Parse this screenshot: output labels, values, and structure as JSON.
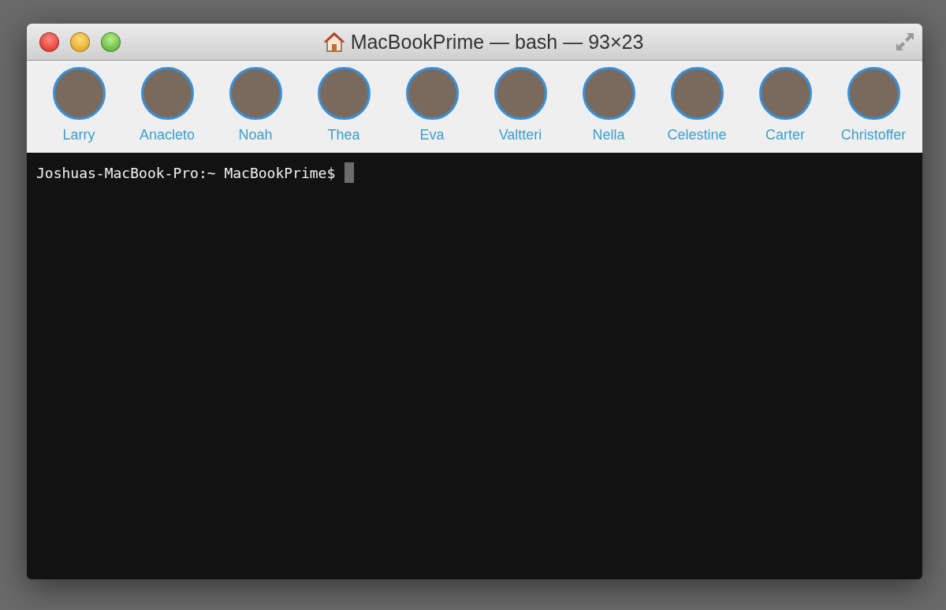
{
  "window": {
    "title": "MacBookPrime — bash — 93×23"
  },
  "contacts": [
    {
      "name": "Larry"
    },
    {
      "name": "Anacleto"
    },
    {
      "name": "Noah"
    },
    {
      "name": "Thea"
    },
    {
      "name": "Eva"
    },
    {
      "name": "Valtteri"
    },
    {
      "name": "Nella"
    },
    {
      "name": "Celestine"
    },
    {
      "name": "Carter"
    },
    {
      "name": "Christoffer"
    }
  ],
  "terminal": {
    "prompt": "Joshuas-MacBook-Pro:~ MacBookPrime$"
  }
}
